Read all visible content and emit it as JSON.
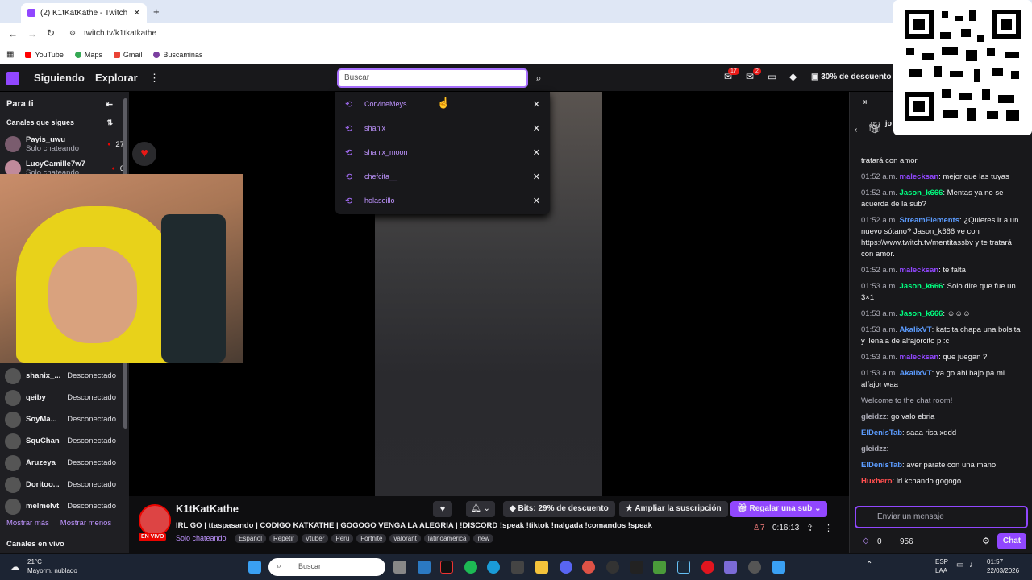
{
  "browser": {
    "tab_title": "(2) K1tKatKathe - Twitch",
    "new_tab": "+",
    "close_tab": "✕",
    "url": "twitch.tv/k1tkatkathe",
    "bookmarks": [
      "YouTube",
      "Maps",
      "Gmail",
      "Buscaminas"
    ]
  },
  "nav": {
    "following": "Siguiendo",
    "explore": "Explorar",
    "more": "⋮",
    "search_placeholder": "Buscar",
    "notif_count_1": "17",
    "notif_count_2": "2",
    "promo": "30% de descuento"
  },
  "search_history": [
    "CorvineMeys",
    "shanix",
    "shanix_moon",
    "chefcita__",
    "holasoillo"
  ],
  "sidebar": {
    "for_you": "Para ti",
    "followed_channels": "Canales que sigues",
    "live": [
      {
        "name": "Payis_uwu",
        "status": "Solo chateando",
        "viewers": "27"
      },
      {
        "name": "LucyCamille7w7",
        "status": "Solo chateando",
        "viewers": "6"
      }
    ],
    "offline": [
      {
        "name": "shanix_...",
        "status": "Desconectado"
      },
      {
        "name": "qeiby",
        "status": "Desconectado"
      },
      {
        "name": "SoyMa...",
        "status": "Desconectado"
      },
      {
        "name": "SquChan",
        "status": "Desconectado"
      },
      {
        "name": "Aruzeya",
        "status": "Desconectado"
      },
      {
        "name": "Doritoo...",
        "status": "Desconectado"
      },
      {
        "name": "melmelvt",
        "status": "Desconectado"
      }
    ],
    "show_more": "Mostrar más",
    "show_less": "Mostrar menos",
    "live_channels": "Canales en vivo"
  },
  "stream": {
    "channel": "K1tKatKathe",
    "live_badge": "EN VIVO",
    "title": "IRL GO | ttaspasando | CODIGO KATKATHE | GOGOGO VENGA LA ALEGRIA | !DISCORD !speak !tiktok !nalgada !comandos !speak",
    "category": "Solo chateando",
    "tags": [
      "Español",
      "Repetir",
      "Vtuber",
      "Perú",
      "Fortnite",
      "valorant",
      "latinoamerica",
      "new"
    ],
    "bits_label": "Bits: 29% de descuento",
    "upgrade_sub": "Ampliar la suscripción",
    "gift_sub": "Regalar una sub",
    "viewers": "7",
    "uptime": "0:16:13"
  },
  "chat": {
    "top_user": "jo",
    "messages": [
      {
        "time": "",
        "user": "",
        "text": "tratará con amor.",
        "color": "#efeff1"
      },
      {
        "time": "01:52 a.m.",
        "user": "malecksan",
        "text": ": mejor que las tuyas",
        "color": "#9147ff"
      },
      {
        "time": "01:52 a.m.",
        "user": "Jason_k666",
        "text": ": Mentas ya no se acuerda de la sub?",
        "color": "#00ff7f"
      },
      {
        "time": "01:52 a.m.",
        "user": "StreamElements",
        "text": ": ¿Quieres ir a un nuevo sótano? Jason_k666 ve con https://www.twitch.tv/mentitassbv y te tratará con amor.",
        "color": "#5c9cff"
      },
      {
        "time": "01:52 a.m.",
        "user": "malecksan",
        "text": ": te falta",
        "color": "#9147ff"
      },
      {
        "time": "01:53 a.m.",
        "user": "Jason_k666",
        "text": ": Solo dire que fue un 3×1",
        "color": "#00ff7f"
      },
      {
        "time": "01:53 a.m.",
        "user": "Jason_k666",
        "text": ":",
        "color": "#00ff7f"
      },
      {
        "time": "01:53 a.m.",
        "user": "AkalixVT",
        "text": ": katcita chapa una bolsita y llenala de alfajorcito p :c",
        "color": "#5c9cff"
      },
      {
        "time": "01:53 a.m.",
        "user": "malecksan",
        "text": ": que juegan ?",
        "color": "#9147ff"
      },
      {
        "time": "01:53 a.m.",
        "user": "AkalixVT",
        "text": ": ya go ahi bajo pa mi alfajor waa",
        "color": "#5c9cff"
      }
    ],
    "welcome": "Welcome to the chat room!",
    "recent": [
      {
        "user": "gleidzz",
        "text": ": go valo ebria",
        "color": "#adadb8"
      },
      {
        "user": "ElDenisTab",
        "text": ": saaa risa xddd",
        "color": "#5c9cff"
      },
      {
        "user": "gleidzz",
        "text": ":",
        "color": "#adadb8"
      },
      {
        "user": "ElDenisTab",
        "text": ": aver parate con una mano",
        "color": "#5c9cff"
      },
      {
        "user": "Huxhero",
        "text": ": lrl kchando gogogo",
        "color": "#ff4f4f"
      }
    ],
    "input_placeholder": "Enviar un mensaje",
    "points": "0",
    "bits": "956",
    "chat_button": "Chat"
  },
  "taskbar": {
    "weather_temp": "21°C",
    "weather_desc": "Mayorm. nublado",
    "search_placeholder": "Buscar",
    "lang": "ESP",
    "region": "LAA",
    "time": "01:57",
    "date": "22/03/2026"
  }
}
